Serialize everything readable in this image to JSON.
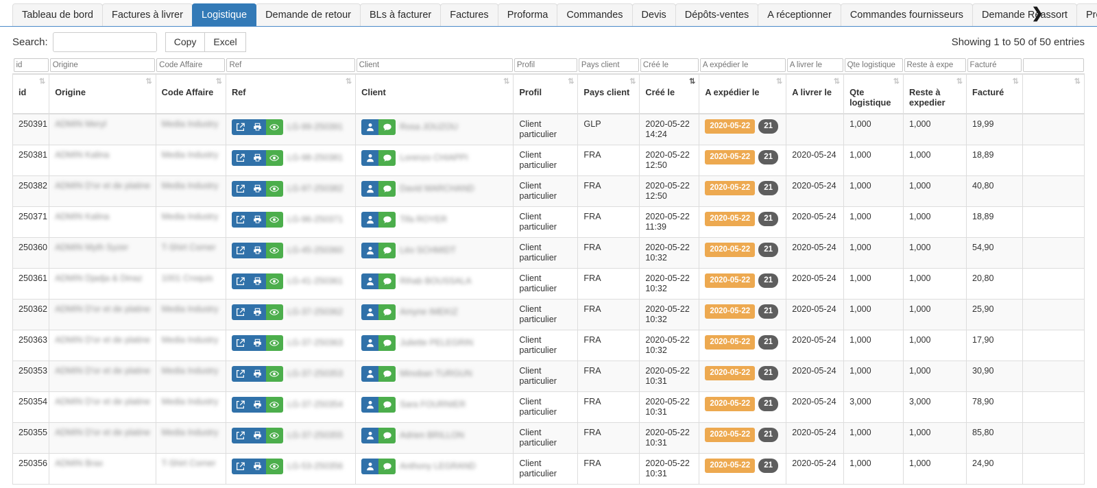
{
  "tabs": [
    {
      "label": "Tableau de bord",
      "active": false
    },
    {
      "label": "Factures à livrer",
      "active": false
    },
    {
      "label": "Logistique",
      "active": true
    },
    {
      "label": "Demande de retour",
      "active": false
    },
    {
      "label": "BLs à facturer",
      "active": false
    },
    {
      "label": "Factures",
      "active": false
    },
    {
      "label": "Proforma",
      "active": false
    },
    {
      "label": "Commandes",
      "active": false
    },
    {
      "label": "Devis",
      "active": false
    },
    {
      "label": "Dépôts-ventes",
      "active": false
    },
    {
      "label": "A réceptionner",
      "active": false
    },
    {
      "label": "Commandes fournisseurs",
      "active": false
    },
    {
      "label": "Demande Reassort",
      "active": false
    },
    {
      "label": "Productions en cours",
      "active": false
    }
  ],
  "tab_scroll_icon": "chevron-right-icon",
  "toolbar": {
    "search_label": "Search:",
    "search_value": "",
    "search_placeholder": "",
    "copy_label": "Copy",
    "excel_label": "Excel",
    "showing_text": "Showing 1 to 50 of 50 entries"
  },
  "colors": {
    "active_tab": "#337ab7",
    "action_blue": "#3071a9",
    "action_green": "#4cae4c",
    "badge_date": "#eda950",
    "badge_num": "#5e5e5e"
  },
  "columns": [
    {
      "key": "id",
      "header": "id",
      "filter_placeholder": "id",
      "sort": "none"
    },
    {
      "key": "origine",
      "header": "Origine",
      "filter_placeholder": "Origine",
      "sort": "none"
    },
    {
      "key": "code",
      "header": "Code Affaire",
      "filter_placeholder": "Code Affaire",
      "sort": "none"
    },
    {
      "key": "ref",
      "header": "Ref",
      "filter_placeholder": "Ref",
      "sort": "none"
    },
    {
      "key": "client",
      "header": "Client",
      "filter_placeholder": "Client",
      "sort": "none"
    },
    {
      "key": "profil",
      "header": "Profil",
      "filter_placeholder": "Profil",
      "sort": "none"
    },
    {
      "key": "pays",
      "header": "Pays client",
      "filter_placeholder": "Pays client",
      "sort": "none"
    },
    {
      "key": "cree",
      "header": "Créé le",
      "filter_placeholder": "Créé le",
      "sort": "desc"
    },
    {
      "key": "expedier",
      "header": "A expédier le",
      "filter_placeholder": "A expédier le",
      "sort": "none"
    },
    {
      "key": "livrer",
      "header": "A livrer le",
      "filter_placeholder": "A livrer le",
      "sort": "none"
    },
    {
      "key": "qte",
      "header": "Qte logistique",
      "filter_placeholder": "Qte logistique",
      "sort": "none"
    },
    {
      "key": "reste",
      "header": "Reste à expedier",
      "filter_placeholder": "Reste à expe",
      "sort": "none"
    },
    {
      "key": "facture",
      "header": "Facturé",
      "filter_placeholder": "Facturé",
      "sort": "none"
    },
    {
      "key": "last",
      "header": "",
      "filter_placeholder": "",
      "sort": "none"
    }
  ],
  "row_actions": {
    "ref_buttons": [
      "external-link-icon",
      "printer-icon",
      "eye-icon"
    ],
    "client_buttons": [
      "user-icon",
      "comment-icon"
    ]
  },
  "rows": [
    {
      "id": "250391",
      "origine": "ADMIN Meryl",
      "code": "Media Industry",
      "ref": "LG-99-250391",
      "client": "Rosa JOUZOU",
      "profil": "Client particulier",
      "pays": "GLP",
      "cree_date": "2020-05-22",
      "cree_time": "14:24",
      "exp_badge": "2020-05-22",
      "exp_num": "21",
      "livrer": "",
      "qte": "1,000",
      "reste": "1,000",
      "facture": "19,99"
    },
    {
      "id": "250381",
      "origine": "ADMIN Kalina",
      "code": "Media Industry",
      "ref": "LG-98-250381",
      "client": "Lorenzo CHIAPPI",
      "profil": "Client particulier",
      "pays": "FRA",
      "cree_date": "2020-05-22",
      "cree_time": "12:50",
      "exp_badge": "2020-05-22",
      "exp_num": "21",
      "livrer": "2020-05-24",
      "qte": "1,000",
      "reste": "1,000",
      "facture": "18,89"
    },
    {
      "id": "250382",
      "origine": "ADMIN D'or et de platine",
      "code": "Media Industry",
      "ref": "LG-97-250382",
      "client": "David MARCHAND",
      "profil": "Client particulier",
      "pays": "FRA",
      "cree_date": "2020-05-22",
      "cree_time": "12:50",
      "exp_badge": "2020-05-22",
      "exp_num": "21",
      "livrer": "2020-05-24",
      "qte": "1,000",
      "reste": "1,000",
      "facture": "40,80"
    },
    {
      "id": "250371",
      "origine": "ADMIN Kalina",
      "code": "Media Industry",
      "ref": "LG-96-250371",
      "client": "Tifa ROYER",
      "profil": "Client particulier",
      "pays": "FRA",
      "cree_date": "2020-05-22",
      "cree_time": "11:39",
      "exp_badge": "2020-05-22",
      "exp_num": "21",
      "livrer": "2020-05-24",
      "qte": "1,000",
      "reste": "1,000",
      "facture": "18,89"
    },
    {
      "id": "250360",
      "origine": "ADMIN Myth Syzer",
      "code": "T-Shirt Corner",
      "ref": "LG-45-250360",
      "client": "Léo SCHMIDT",
      "profil": "Client particulier",
      "pays": "FRA",
      "cree_date": "2020-05-22",
      "cree_time": "10:32",
      "exp_badge": "2020-05-22",
      "exp_num": "21",
      "livrer": "2020-05-24",
      "qte": "1,000",
      "reste": "1,000",
      "facture": "54,90"
    },
    {
      "id": "250361",
      "origine": "ADMIN Djadja & Dinaz",
      "code": "1001 Croquis",
      "ref": "LG-41-250361",
      "client": "Rihab BOUSSALA",
      "profil": "Client particulier",
      "pays": "FRA",
      "cree_date": "2020-05-22",
      "cree_time": "10:32",
      "exp_badge": "2020-05-22",
      "exp_num": "21",
      "livrer": "2020-05-24",
      "qte": "1,000",
      "reste": "1,000",
      "facture": "20,80"
    },
    {
      "id": "250362",
      "origine": "ADMIN D'or et de platine",
      "code": "Media Industry",
      "ref": "LG-37-250362",
      "client": "Amyne IMEKIZ",
      "profil": "Client particulier",
      "pays": "FRA",
      "cree_date": "2020-05-22",
      "cree_time": "10:32",
      "exp_badge": "2020-05-22",
      "exp_num": "21",
      "livrer": "2020-05-24",
      "qte": "1,000",
      "reste": "1,000",
      "facture": "25,90"
    },
    {
      "id": "250363",
      "origine": "ADMIN D'or et de platine",
      "code": "Media Industry",
      "ref": "LG-37-250363",
      "client": "Juliette PELEGRIN",
      "profil": "Client particulier",
      "pays": "FRA",
      "cree_date": "2020-05-22",
      "cree_time": "10:32",
      "exp_badge": "2020-05-22",
      "exp_num": "21",
      "livrer": "2020-05-24",
      "qte": "1,000",
      "reste": "1,000",
      "facture": "17,90"
    },
    {
      "id": "250353",
      "origine": "ADMIN D'or et de platine",
      "code": "Media Industry",
      "ref": "LG-37-250353",
      "client": "Minoban TURGUN",
      "profil": "Client particulier",
      "pays": "FRA",
      "cree_date": "2020-05-22",
      "cree_time": "10:31",
      "exp_badge": "2020-05-22",
      "exp_num": "21",
      "livrer": "2020-05-24",
      "qte": "1,000",
      "reste": "1,000",
      "facture": "30,90"
    },
    {
      "id": "250354",
      "origine": "ADMIN D'or et de platine",
      "code": "Media Industry",
      "ref": "LG-37-250354",
      "client": "Sara FOURNIER",
      "profil": "Client particulier",
      "pays": "FRA",
      "cree_date": "2020-05-22",
      "cree_time": "10:31",
      "exp_badge": "2020-05-22",
      "exp_num": "21",
      "livrer": "2020-05-24",
      "qte": "3,000",
      "reste": "3,000",
      "facture": "78,90"
    },
    {
      "id": "250355",
      "origine": "ADMIN D'or et de platine",
      "code": "Media Industry",
      "ref": "LG-37-250355",
      "client": "Adrien BRILLON",
      "profil": "Client particulier",
      "pays": "FRA",
      "cree_date": "2020-05-22",
      "cree_time": "10:31",
      "exp_badge": "2020-05-22",
      "exp_num": "21",
      "livrer": "2020-05-24",
      "qte": "1,000",
      "reste": "1,000",
      "facture": "85,80"
    },
    {
      "id": "250356",
      "origine": "ADMIN Brax",
      "code": "T-Shirt Corner",
      "ref": "LG-53-250356",
      "client": "Anthony LEGRAND",
      "profil": "Client particulier",
      "pays": "FRA",
      "cree_date": "2020-05-22",
      "cree_time": "10:31",
      "exp_badge": "2020-05-22",
      "exp_num": "21",
      "livrer": "2020-05-24",
      "qte": "1,000",
      "reste": "1,000",
      "facture": "24,90"
    }
  ]
}
